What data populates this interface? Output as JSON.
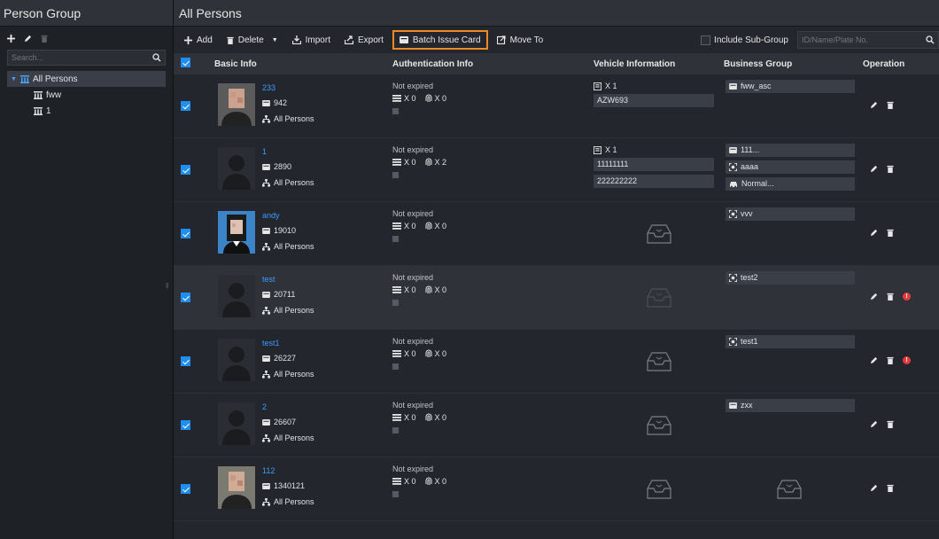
{
  "left_panel": {
    "title": "Person Group",
    "search_placeholder": "Search...",
    "tree": [
      {
        "label": "All Persons"
      },
      {
        "label": "fww"
      },
      {
        "label": "1"
      }
    ]
  },
  "right_panel": {
    "title": "All Persons",
    "toolbar": {
      "add": "Add",
      "delete": "Delete",
      "import": "Import",
      "export": "Export",
      "batch_issue_card": "Batch Issue Card",
      "move_to": "Move To",
      "include_subgroup": "Include Sub-Group",
      "search_placeholder": "ID/Name/Plate No."
    },
    "columns": {
      "basic": "Basic Info",
      "auth": "Authentication Info",
      "vehicle": "Vehicle Information",
      "business": "Business Group",
      "operation": "Operation"
    }
  },
  "rows": [
    {
      "name": "233",
      "id": "942",
      "group": "All Persons",
      "auth_status": "Not expired",
      "card_count": "X 0",
      "fp_count": "X 0",
      "vehicle_count": "X 1",
      "plates": [
        "AZW693"
      ],
      "business": [
        {
          "label": "fww_asc",
          "icon": "card-icon"
        }
      ],
      "warning": false
    },
    {
      "name": "1",
      "id": "2890",
      "group": "All Persons",
      "auth_status": "Not expired",
      "card_count": "X 0",
      "fp_count": "X 2",
      "vehicle_count": "X 1",
      "plates": [
        "11111111",
        "222222222"
      ],
      "business": [
        {
          "label": "111...",
          "icon": "card-icon"
        },
        {
          "label": "aaaa",
          "icon": "face-icon"
        },
        {
          "label": "Normal...",
          "icon": "car-icon"
        }
      ],
      "warning": false
    },
    {
      "name": "andy",
      "id": "19010",
      "group": "All Persons",
      "auth_status": "Not expired",
      "card_count": "X 0",
      "fp_count": "X 0",
      "vehicle_count": "",
      "plates": [],
      "business": [
        {
          "label": "vvv",
          "icon": "face-icon"
        }
      ],
      "warning": false
    },
    {
      "name": "test",
      "id": "20711",
      "group": "All Persons",
      "auth_status": "Not expired",
      "card_count": "X 0",
      "fp_count": "X 0",
      "vehicle_count": "",
      "plates": [],
      "business": [
        {
          "label": "test2",
          "icon": "face-icon"
        }
      ],
      "warning": true
    },
    {
      "name": "test1",
      "id": "26227",
      "group": "All Persons",
      "auth_status": "Not expired",
      "card_count": "X 0",
      "fp_count": "X 0",
      "vehicle_count": "",
      "plates": [],
      "business": [
        {
          "label": "test1",
          "icon": "face-icon"
        }
      ],
      "warning": true
    },
    {
      "name": "2",
      "id": "26607",
      "group": "All Persons",
      "auth_status": "Not expired",
      "card_count": "X 0",
      "fp_count": "X 0",
      "vehicle_count": "",
      "plates": [],
      "business": [
        {
          "label": "zxx",
          "icon": "card-icon"
        }
      ],
      "warning": false
    },
    {
      "name": "112",
      "id": "1340121",
      "group": "All Persons",
      "auth_status": "Not expired",
      "card_count": "X 0",
      "fp_count": "X 0",
      "vehicle_count": "",
      "plates": [],
      "business": [],
      "warning": false
    }
  ],
  "selected_row_index": 3,
  "colors": {
    "accent": "#1f8ef1",
    "link": "#3d9bff",
    "highlight": "#f08a24",
    "warning": "#e23b3b"
  }
}
